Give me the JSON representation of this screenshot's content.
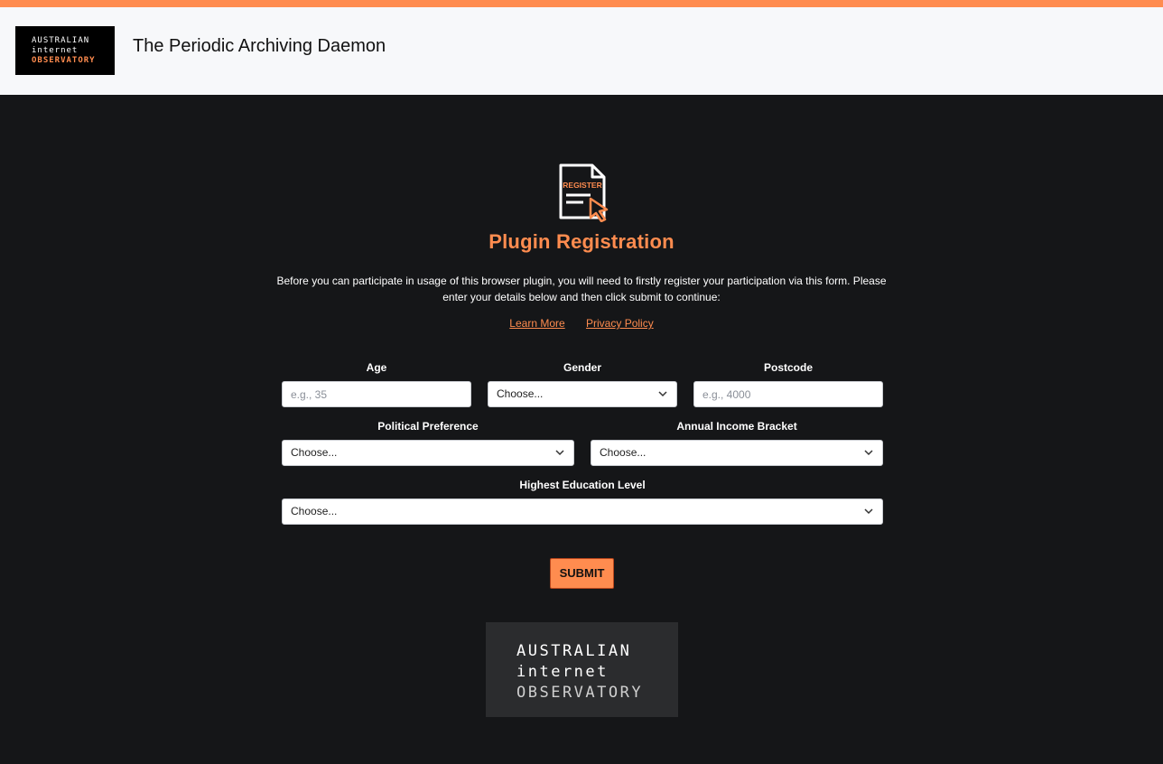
{
  "header": {
    "logo": {
      "line1": "AUSTRALIAN",
      "line2": "internet",
      "line3": "OBSERVATORY"
    },
    "title": "The Periodic Archiving Daemon"
  },
  "colors": {
    "accent": "#ff8c4f",
    "background": "#151618",
    "header_bg": "#f7f8fa"
  },
  "register_icon": {
    "name": "register-document-cursor-icon",
    "text": "REGISTER"
  },
  "main": {
    "title": "Plugin Registration",
    "intro": "Before you can participate in usage of this browser plugin, you will need to firstly register your participation via this form. Please enter your details below and then click submit to continue:",
    "links": {
      "learn_more": "Learn More",
      "privacy_policy": "Privacy Policy"
    }
  },
  "form": {
    "age": {
      "label": "Age",
      "placeholder": "e.g., 35",
      "value": ""
    },
    "gender": {
      "label": "Gender",
      "value": "Choose..."
    },
    "postcode": {
      "label": "Postcode",
      "placeholder": "e.g., 4000",
      "value": ""
    },
    "political": {
      "label": "Political Preference",
      "value": "Choose..."
    },
    "income": {
      "label": "Annual Income Bracket",
      "value": "Choose..."
    },
    "education": {
      "label": "Highest Education Level",
      "value": "Choose..."
    },
    "submit_label": "SUBMIT"
  },
  "footer_logo": {
    "line1": "AUSTRALIAN",
    "line2": "internet",
    "line3": "OBSERVATORY"
  }
}
